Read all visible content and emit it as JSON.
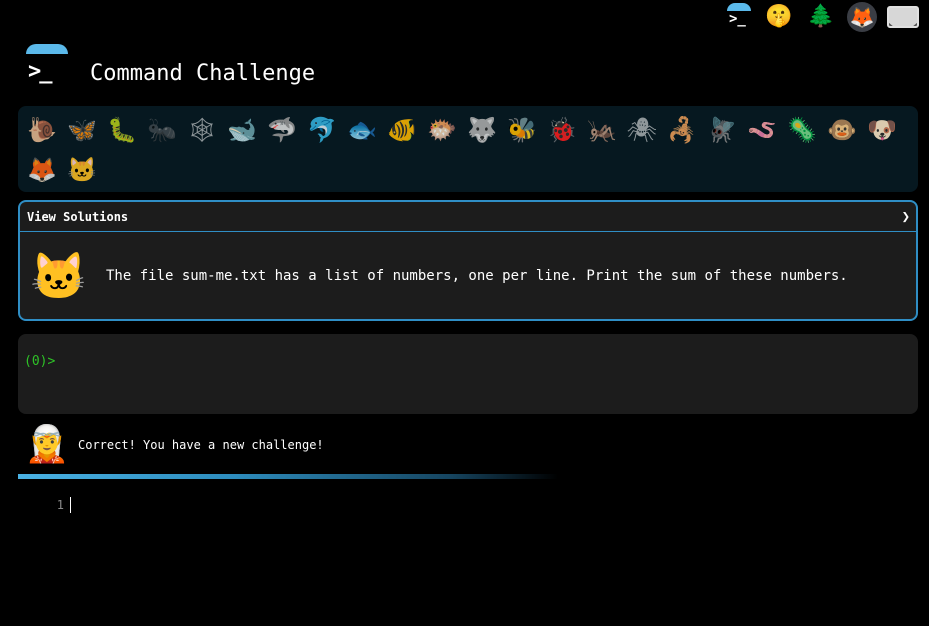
{
  "header": {
    "title": "Command Challenge",
    "logo_prompt": ">_"
  },
  "top_icons": [
    {
      "name": "terminal-icon",
      "glyph": ">_"
    },
    {
      "name": "shushing-face-icon",
      "glyph": "🤫"
    },
    {
      "name": "tree-icon",
      "glyph": "🌲"
    },
    {
      "name": "gitlab-fox-icon",
      "glyph": "🦊"
    },
    {
      "name": "mail-icon",
      "glyph": "✉"
    }
  ],
  "animals": [
    {
      "name": "snail-icon",
      "glyph": "🐌"
    },
    {
      "name": "butterfly-icon",
      "glyph": "🦋"
    },
    {
      "name": "caterpillar-icon",
      "glyph": "🐛"
    },
    {
      "name": "ant-icon",
      "glyph": "🐜"
    },
    {
      "name": "spider-web-icon",
      "glyph": "🕸"
    },
    {
      "name": "whale-icon",
      "glyph": "🐋"
    },
    {
      "name": "shark-icon",
      "glyph": "🦈"
    },
    {
      "name": "dolphin-icon",
      "glyph": "🐬"
    },
    {
      "name": "fish-icon",
      "glyph": "🐟"
    },
    {
      "name": "tropical-fish-icon",
      "glyph": "🐠"
    },
    {
      "name": "blowfish-icon",
      "glyph": "🐡"
    },
    {
      "name": "wolf-icon",
      "glyph": "🐺"
    },
    {
      "name": "bee-icon",
      "glyph": "🐝"
    },
    {
      "name": "ladybug-icon",
      "glyph": "🐞"
    },
    {
      "name": "cricket-icon",
      "glyph": "🦗"
    },
    {
      "name": "spider-icon",
      "glyph": "🕷"
    },
    {
      "name": "scorpion-icon",
      "glyph": "🦂"
    },
    {
      "name": "fly-icon",
      "glyph": "🪰"
    },
    {
      "name": "worm-icon",
      "glyph": "🪱"
    },
    {
      "name": "microbe-icon",
      "glyph": "🦠"
    },
    {
      "name": "monkey-icon",
      "glyph": "🐵"
    },
    {
      "name": "dog-icon",
      "glyph": "🐶"
    },
    {
      "name": "fox-icon",
      "glyph": "🦊"
    },
    {
      "name": "cat-icon",
      "glyph": "🐱"
    }
  ],
  "challenge": {
    "view_solutions_label": "View Solutions",
    "chevron": "❯",
    "avatar_glyph": "🐱",
    "text": "The file sum-me.txt has a list of numbers, one per line. Print the sum of these numbers."
  },
  "terminal": {
    "prompt": "(0)>"
  },
  "message": {
    "avatar_glyph": "🧝",
    "text": "Correct! You have a new challenge!"
  },
  "editor": {
    "line_number": "1"
  }
}
